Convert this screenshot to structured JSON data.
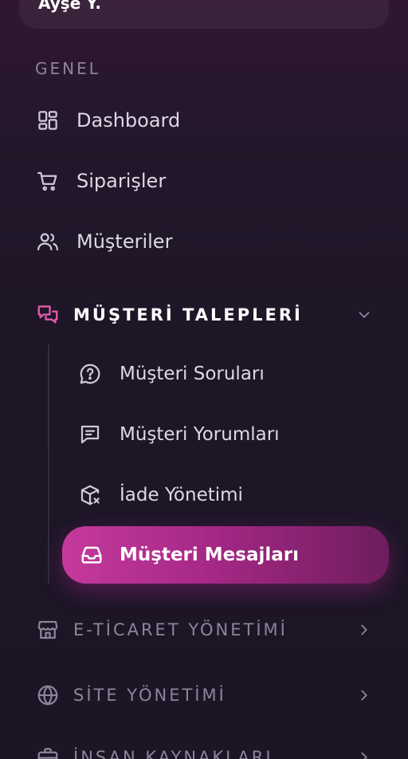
{
  "user": {
    "name": "Ayşe Y."
  },
  "section": {
    "label": "GENEL"
  },
  "nav": [
    {
      "label": "Dashboard",
      "icon": "dashboard-grid-icon"
    },
    {
      "label": "Siparişler",
      "icon": "cart-icon"
    },
    {
      "label": "Müşteriler",
      "icon": "users-icon"
    }
  ],
  "groups": {
    "customer_requests": {
      "label": "MÜŞTERİ TALEPLERİ",
      "icon": "chat-bubbles-icon",
      "state": "expanded",
      "accent": "#e05aa8",
      "items": [
        {
          "label": "Müşteri Soruları",
          "icon": "question-bubble-icon"
        },
        {
          "label": "Müşteri Yorumları",
          "icon": "comment-lines-icon"
        },
        {
          "label": "İade Yönetimi",
          "icon": "package-return-icon"
        },
        {
          "label": "Müşteri Mesajları",
          "icon": "inbox-icon",
          "active": true
        }
      ]
    },
    "ecommerce": {
      "label": "E-TİCARET YÖNETİMİ",
      "icon": "store-icon",
      "state": "collapsed"
    },
    "site": {
      "label": "SİTE YÖNETİMİ",
      "icon": "globe-icon",
      "state": "collapsed"
    },
    "hr": {
      "label": "İNSAN KAYNAKLARI",
      "icon": "briefcase-icon",
      "state": "collapsed"
    }
  },
  "colors": {
    "active_gradient_start": "#c53a9c",
    "active_gradient_end": "#6e1d5e",
    "muted_text": "#8e8499",
    "text": "#ddd7e6"
  }
}
